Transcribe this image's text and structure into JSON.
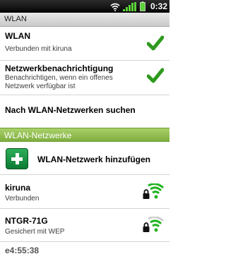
{
  "status_bar": {
    "time": "0:32",
    "icons": [
      "wifi-signal-icon",
      "cell-signal-icon",
      "battery-icon"
    ]
  },
  "title_bar": {
    "title": "WLAN"
  },
  "settings": {
    "wlan": {
      "title": "WLAN",
      "summary": "Verbunden mit kiruna",
      "checked": true
    },
    "notification": {
      "title": "Netzwerkbenachrichtigung",
      "summary_line1": "Benachrichtigen, wenn ein offenes",
      "summary_line2": "Netzwerk verfügbar ist",
      "checked": true
    },
    "scan": {
      "title": "Nach WLAN-Netzwerken suchen"
    }
  },
  "section": {
    "label": "WLAN-Netzwerke"
  },
  "add_network": {
    "label": "WLAN-Netzwerk hinzufügen"
  },
  "networks": [
    {
      "ssid": "kiruna",
      "status": "Verbunden",
      "secured": true,
      "signal": "strong",
      "icon": "wifi-locked-icon"
    },
    {
      "ssid": "NTGR-71G",
      "status": "Gesichert mit WEP",
      "secured": true,
      "signal": "medium",
      "icon": "wifi-locked-icon"
    },
    {
      "ssid": "e4:55:38",
      "status": "",
      "secured": true,
      "signal": "weak",
      "icon": "wifi-locked-icon"
    }
  ],
  "colors": {
    "accent_green": "#2e9a1e",
    "section_green": "#8fbd4c",
    "wifi_green": "#22b422"
  }
}
